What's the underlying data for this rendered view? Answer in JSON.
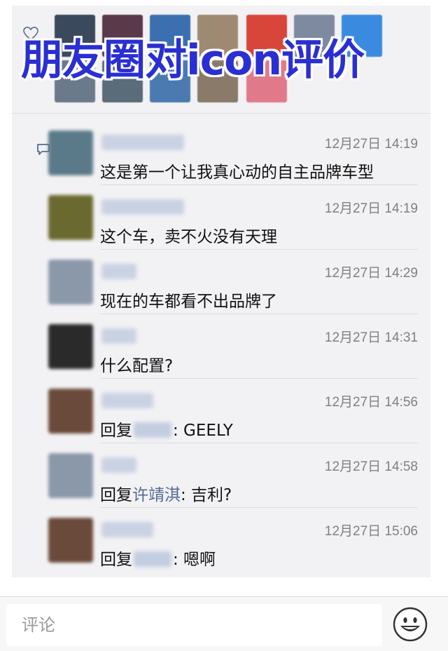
{
  "overlay_title": "朋友圈对icon评价",
  "likes": {
    "icon": "heart-outline-icon",
    "avatar_colors": [
      "#3a4a5c",
      "#5a3a4a",
      "#3b6fb0",
      "#9e8a72",
      "#d8453a",
      "#7e8aa0",
      "#3a8be0",
      "#6b7a8a",
      "#5a6b7a",
      "#4a7ab0",
      "#8a7a6a",
      "#e07a8a"
    ]
  },
  "comments_icon": "comment-bubble-icon",
  "comments": [
    {
      "avatar": "#5a7a8a",
      "name_color": "#c3cde0",
      "name_width": 118,
      "time": "12月27日 14:19",
      "text": "这是第一个让我真心动的自主品牌车型"
    },
    {
      "avatar": "#6a6a30",
      "name_color": "#c3cde0",
      "name_width": 118,
      "time": "12月27日 14:19",
      "text": "这个车，卖不火没有天理"
    },
    {
      "avatar": "#8a98aa",
      "name_color": "#c3cde0",
      "name_width": 50,
      "time": "12月27日 14:29",
      "text": "现在的车都看不出品牌了"
    },
    {
      "avatar": "#2a2a2a",
      "name_color": "#c3cde0",
      "name_width": 50,
      "time": "12月27日 14:31",
      "text": "什么配置?"
    },
    {
      "avatar": "#6a4a3a",
      "name_color": "#c3cde0",
      "name_width": 74,
      "time": "12月27日 14:56",
      "text_prefix": "回复",
      "reply_to_hidden": true,
      "text": ": GEELY"
    },
    {
      "avatar": "#8a98aa",
      "name_color": "#c3cde0",
      "name_width": 50,
      "time": "12月27日 14:58",
      "text_prefix": "回复",
      "reply_to": "许靖淇",
      "text": ": 吉利?"
    },
    {
      "avatar": "#6a4a3a",
      "name_color": "#c3cde0",
      "name_width": 74,
      "time": "12月27日 15:06",
      "text_prefix": "回复",
      "reply_to_hidden": true,
      "text": ": 嗯啊"
    }
  ],
  "input": {
    "placeholder": "评论"
  },
  "emoji_button_icon": "smiley-face-icon"
}
